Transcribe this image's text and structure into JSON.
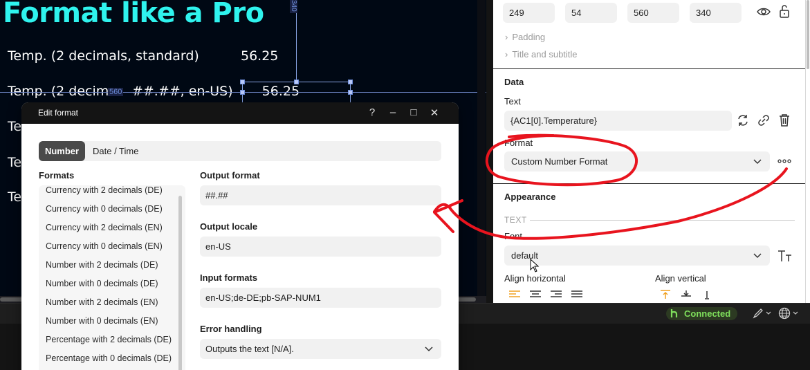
{
  "canvas": {
    "title": "Format like a Pro",
    "rows": [
      {
        "label": "Temp. (2 decimals, standard)",
        "value": "56.25"
      },
      {
        "label": "Temp. (2 decima",
        "label_rest": "##.##, en-US)",
        "value": "56.25"
      },
      {
        "label": "Te"
      },
      {
        "label": "Te"
      },
      {
        "label": "Te"
      }
    ],
    "guide_width_label": "560",
    "guide_height_label": "340"
  },
  "panel": {
    "position_fields": [
      "249",
      "54",
      "560",
      "340"
    ],
    "collapse_items": [
      "Padding",
      "Title and subtitle"
    ],
    "data_section_title": "Data",
    "text_label": "Text",
    "text_value": "{AC1[0].Temperature}",
    "format_label": "Format",
    "format_value": "Custom Number Format",
    "appearance_title": "Appearance",
    "text_subsection": "TEXT",
    "font_label": "Font",
    "font_value": "default",
    "align_horizontal_label": "Align horizontal",
    "align_vertical_label": "Align vertical",
    "icons": [
      "eye-icon",
      "lock-icon",
      "refresh-icon",
      "link-icon",
      "trash-icon",
      "more-icon",
      "font-size-icon"
    ]
  },
  "statusbar": {
    "connected_label": "Connected",
    "connected_color": "#7fe05c",
    "icons": [
      "brush-icon",
      "globe-icon"
    ]
  },
  "dialog": {
    "title": "Edit format",
    "controls": [
      "?",
      "–",
      "□",
      "✕"
    ],
    "tabs": {
      "active": "Number",
      "inactive": "Date / Time"
    },
    "formats_label": "Formats",
    "formats": [
      "Currency with 2 decimals (DE)",
      "Currency with 0 decimals (DE)",
      "Currency with 2 decimals (EN)",
      "Currency with 0 decimals (EN)",
      "Number with 2 decimals (DE)",
      "Number with 0 decimals (DE)",
      "Number with 2 decimals (EN)",
      "Number with 0 decimals (EN)",
      "Percentage with 2 decimals (DE)",
      "Percentage with 0 decimals (DE)"
    ],
    "output_format_label": "Output format",
    "output_format_value": "##.##",
    "output_locale_label": "Output locale",
    "output_locale_value": "en-US",
    "input_formats_label": "Input formats",
    "input_formats_value": "en-US;de-DE;pb-SAP-NUM1",
    "error_handling_label": "Error handling",
    "error_handling_value": "Outputs the text [N/A]."
  },
  "colors": {
    "title_cyan": "#2ff3ee",
    "canvas_bg": "#000814",
    "annotation_red": "#e8141e",
    "accent_orange": "#f0a020"
  }
}
